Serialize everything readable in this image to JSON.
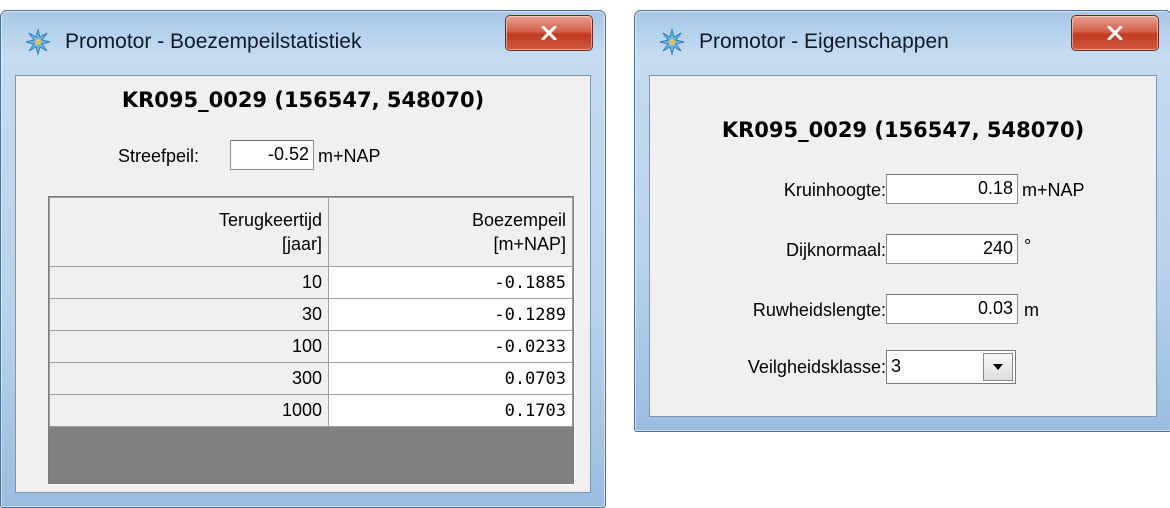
{
  "stats_window": {
    "title": "Promotor - Boezempeilstatistiek",
    "heading": "KR095_0029 (156547, 548070)",
    "streefpeil_label": "Streefpeil:",
    "streefpeil_value": "-0.52",
    "streefpeil_unit": "m+NAP",
    "table": {
      "col1_header_line1": "Terugkeertijd",
      "col1_header_line2": "[jaar]",
      "col2_header_line1": "Boezempeil",
      "col2_header_line2": "[m+NAP]",
      "rows": [
        {
          "t": "10",
          "v": "-0.1885"
        },
        {
          "t": "30",
          "v": "-0.1289"
        },
        {
          "t": "100",
          "v": "-0.0233"
        },
        {
          "t": "300",
          "v": "0.0703"
        },
        {
          "t": "1000",
          "v": "0.1703"
        }
      ]
    }
  },
  "props_window": {
    "title": "Promotor - Eigenschappen",
    "heading": "KR095_0029 (156547, 548070)",
    "kruinhoogte_label": "Kruinhoogte:",
    "kruinhoogte_value": "0.18",
    "kruinhoogte_unit": "m+NAP",
    "dijknormaal_label": "Dijknormaal:",
    "dijknormaal_value": "240",
    "dijknormaal_unit": "°",
    "ruwheid_label": "Ruwheidslengte:",
    "ruwheid_value": "0.03",
    "ruwheid_unit": "m",
    "veiligheid_label": "Veilgheidsklasse:",
    "veiligheid_value": "3"
  },
  "icons": {
    "app": "promotor-app-icon",
    "close": "close-icon",
    "dropdown": "chevron-down-icon"
  },
  "colors": {
    "close_button": "#c0391f",
    "window_frame": "#b9d3ec",
    "client_bg": "#f0f0f0"
  }
}
